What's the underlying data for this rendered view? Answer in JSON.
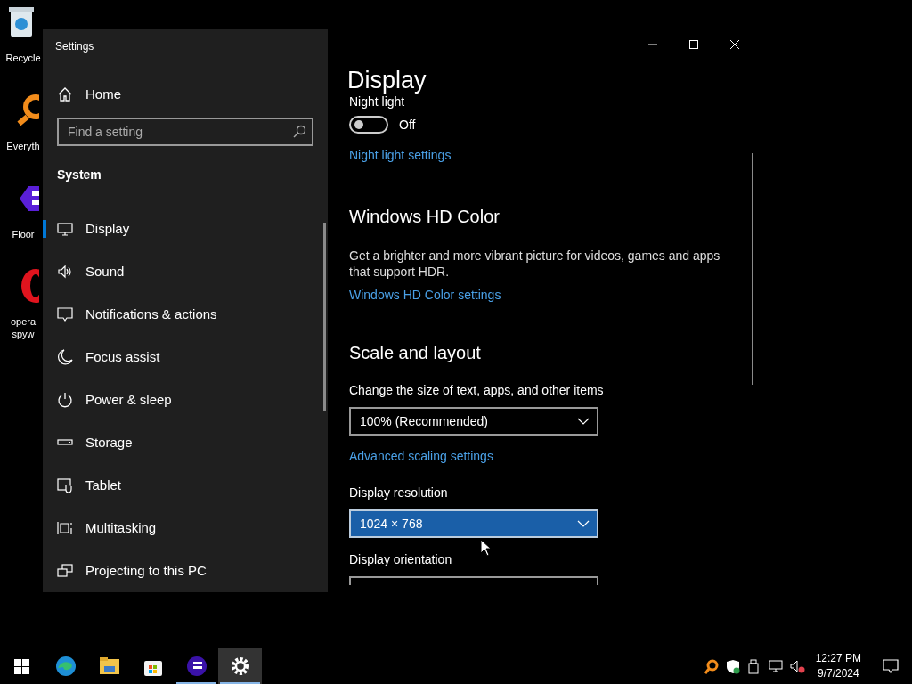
{
  "desktop_icons": [
    {
      "label": "Recycle",
      "kind": "recycle"
    },
    {
      "label": "Everyth",
      "kind": "search"
    },
    {
      "label": "Floor",
      "kind": "floor"
    },
    {
      "label": "opera spyw",
      "kind": "opera"
    }
  ],
  "window": {
    "title": "Settings"
  },
  "sidebar": {
    "home": "Home",
    "search": {
      "placeholder": "Find a setting"
    },
    "section": "System",
    "items": [
      {
        "label": "Display",
        "selected": true
      },
      {
        "label": "Sound",
        "selected": false
      },
      {
        "label": "Notifications & actions",
        "selected": false
      },
      {
        "label": "Focus assist",
        "selected": false
      },
      {
        "label": "Power & sleep",
        "selected": false
      },
      {
        "label": "Storage",
        "selected": false
      },
      {
        "label": "Tablet",
        "selected": false
      },
      {
        "label": "Multitasking",
        "selected": false
      },
      {
        "label": "Projecting to this PC",
        "selected": false
      }
    ]
  },
  "content": {
    "title": "Display",
    "night_light": {
      "label": "Night light",
      "on": false,
      "state": "Off",
      "link": "Night light settings"
    },
    "hd_color": {
      "heading": "Windows HD Color",
      "description": "Get a brighter and more vibrant picture for videos, games and apps that support HDR.",
      "link": "Windows HD Color settings"
    },
    "scale": {
      "heading": "Scale and layout",
      "size_label": "Change the size of text, apps, and other items",
      "size_value": "100% (Recommended)",
      "link": "Advanced scaling settings",
      "resolution_label": "Display resolution",
      "resolution_value": "1024 × 768",
      "resolution_focused": true,
      "orientation_label": "Display orientation"
    }
  },
  "taskbar": {
    "apps": [
      {
        "kind": "edge",
        "running": false,
        "active": false
      },
      {
        "kind": "folder",
        "running": false,
        "active": false
      },
      {
        "kind": "store",
        "running": false,
        "active": false
      },
      {
        "kind": "floor",
        "running": true,
        "active": false
      },
      {
        "kind": "settings",
        "running": true,
        "active": true
      }
    ],
    "time": "12:27 PM",
    "date": "9/7/2024"
  }
}
